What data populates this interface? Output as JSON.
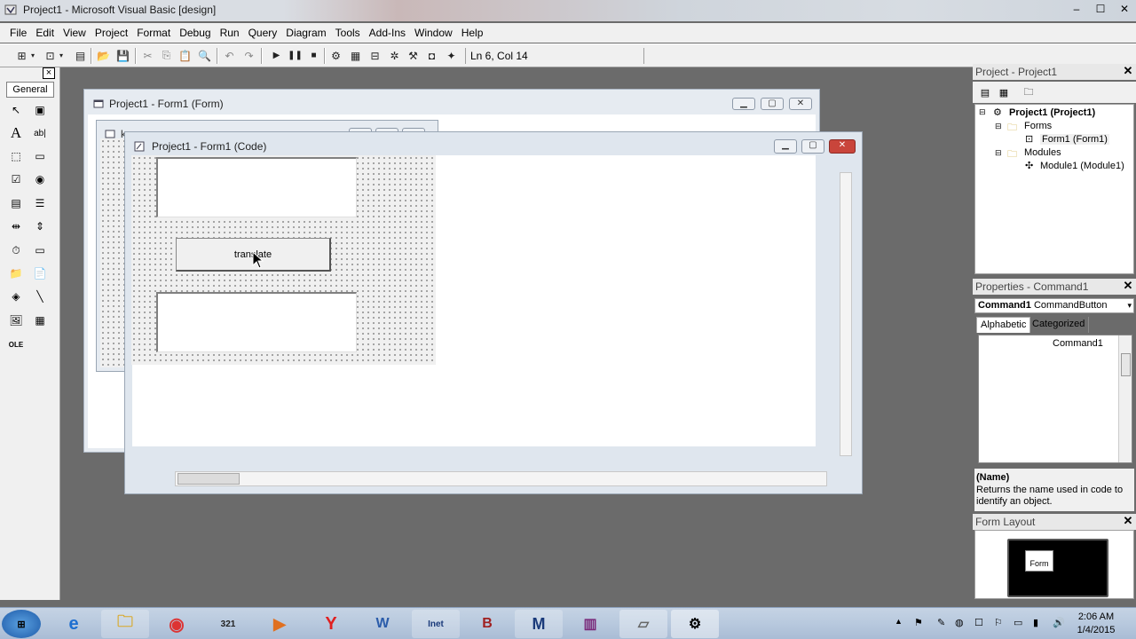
{
  "window": {
    "title": "Project1 - Microsoft Visual Basic [design]",
    "minimize": "–",
    "maximize": "☐",
    "close": "✕"
  },
  "menu": [
    "File",
    "Edit",
    "View",
    "Project",
    "Format",
    "Debug",
    "Run",
    "Query",
    "Diagram",
    "Tools",
    "Add-Ins",
    "Window",
    "Help"
  ],
  "toolbar": {
    "status": "Ln 6, Col 14"
  },
  "toolbox": {
    "tab_label": "General",
    "close": "×"
  },
  "form_window": {
    "title": "Project1 - Form1 (Form)"
  },
  "code_window": {
    "title": "Project1 - Form1 (Code)"
  },
  "inner_form": {
    "title_fragment": "k"
  },
  "designer": {
    "command_caption": "translate"
  },
  "project_panel": {
    "title": "Project - Project1",
    "tree": {
      "root": "Project1 (Project1)",
      "forms_folder": "Forms",
      "form1": "Form1 (Form1)",
      "modules_folder": "Modules",
      "module1": "Module1 (Module1)"
    }
  },
  "properties_panel": {
    "title": "Properties - Command1",
    "object_name": "Command1",
    "object_type": "CommandButton",
    "tab_alphabetic": "Alphabetic",
    "tab_categorized": "Categorized",
    "first_row_value": "Command1",
    "desc_title": "(Name)",
    "desc_text": "Returns the name used in code to identify an object."
  },
  "layout_panel": {
    "title": "Form Layout",
    "form_label": "Form"
  },
  "taskbar": {
    "clock_time": "2:06 AM",
    "clock_date": "1/4/2015",
    "inet_label": "Inet"
  },
  "colors": {
    "accent_close": "#c9453b",
    "taskbar": "#b8c9de",
    "mdi_background": "#6b6b6b"
  }
}
